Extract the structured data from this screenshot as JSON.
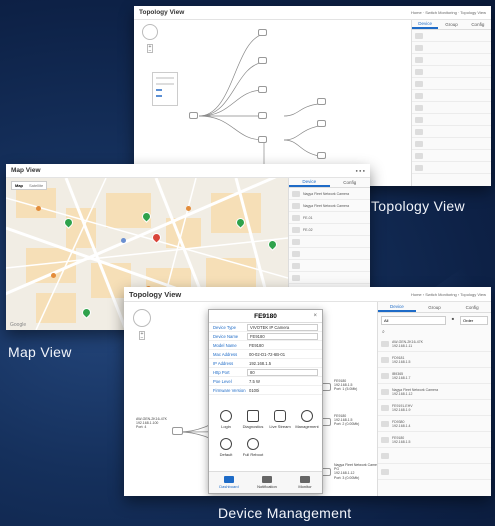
{
  "captions": {
    "topology": "Topology View",
    "map": "Map View",
    "device": "Device Management"
  },
  "topology_small": {
    "title": "Topology View",
    "crumbs": "Home · Switch Monitoring · Topology View",
    "tabs": [
      "Device",
      "Group",
      "Config"
    ]
  },
  "map_view": {
    "title": "Map View",
    "map_buttons": [
      "Map",
      "Satellite"
    ],
    "google_label": "Google",
    "tabs": [
      "Device",
      "Config"
    ],
    "list": [
      "Nagya Fleet Network Camera",
      "Nagya Fleet Network Camera",
      "FE-01",
      "FE-02"
    ]
  },
  "topology_main": {
    "title": "Topology View",
    "crumbs": [
      "Home",
      "Switch Monitoring",
      "Topology View"
    ],
    "tabs": [
      "Device",
      "Group",
      "Config"
    ],
    "filter_value": "All",
    "filter_sort": "Order",
    "root_label": [
      "AW-GEN-2K16-47K",
      "192.168.1.100",
      "Port: 4"
    ],
    "nodes": [
      {
        "label": [
          "FE9180",
          "192.168.1.5",
          "Port: 1 (5.0Mb)"
        ]
      },
      {
        "label": [
          "FE9180",
          "192.168.1.5",
          "Port: 2 (0.00Mb)"
        ]
      },
      {
        "label": [
          "Nagya Fleet Network Camera",
          "PG",
          "192.168.1.12",
          "Port: 3 (0.00Mb)"
        ]
      }
    ],
    "list": [
      {
        "name": "AW-GEN-2K16-47K",
        "sub": "192.168.1.11"
      },
      {
        "name": "FD9181",
        "sub": "192.168.1.5"
      },
      {
        "name": "IB9365",
        "sub": "192.168.1.7"
      },
      {
        "name": "Nagya Fleet Network Camera",
        "sub": "192.168.1.12"
      },
      {
        "name": "FE9191-EHV",
        "sub": "192.168.1.9"
      },
      {
        "name": "FD9380",
        "sub": "192.168.1.4"
      },
      {
        "name": "FE9180",
        "sub": "192.168.1.5"
      }
    ]
  },
  "device_modal": {
    "title": "FE9180",
    "fields": [
      {
        "key": "Device Type",
        "value": "VIVOTEK IP Camera"
      },
      {
        "key": "Device Name",
        "value": "FE9180"
      },
      {
        "key": "Model Name",
        "value": "FE9180"
      },
      {
        "key": "Mac Address",
        "value": "00-02-D1-72-6B-01"
      },
      {
        "key": "IP Address",
        "value": "192.168.1.5"
      },
      {
        "key": "Http Port",
        "value": "80"
      },
      {
        "key": "Poe Level",
        "value": "7.5 W"
      },
      {
        "key": "Firmware Version",
        "value": "0100i"
      }
    ],
    "actions": [
      "Login",
      "Diagnostics",
      "Live Stream",
      "Management",
      "Default",
      "Full Reboot"
    ],
    "footer_tabs": [
      "Dashboard",
      "Notification",
      "Monitor"
    ]
  },
  "colors": {
    "accent": "#1e6bc7",
    "pin_green": "#2fa24b",
    "pin_red": "#d9453a"
  }
}
